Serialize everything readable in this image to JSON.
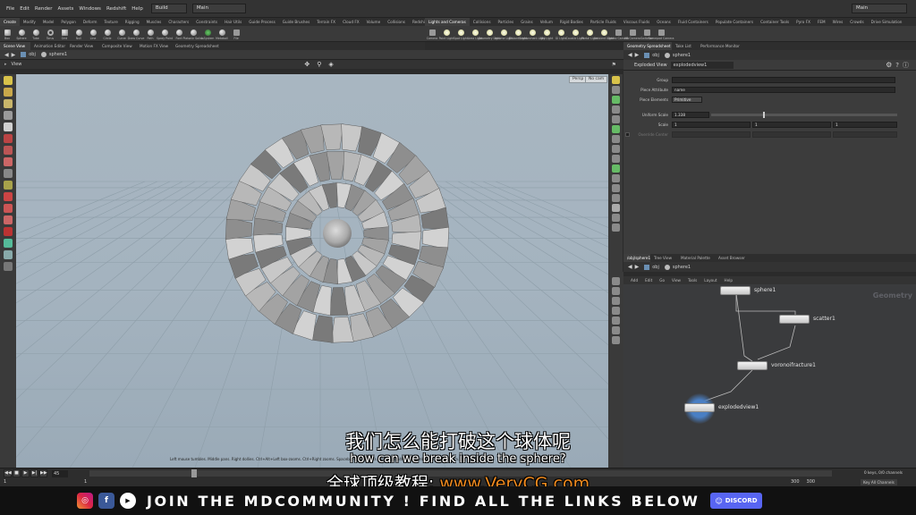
{
  "menubar": {
    "menus": [
      "File",
      "Edit",
      "Render",
      "Assets",
      "Windows",
      "Redshift",
      "Help"
    ],
    "desktop": "Build",
    "context": "Main",
    "right_desktop": "Main"
  },
  "shelf": {
    "tabs": [
      "Create",
      "Modify",
      "Model",
      "Polygon",
      "Deform",
      "Texture",
      "Rigging",
      "Muscles",
      "Characters",
      "Constraints",
      "Hair Utils",
      "Guide Process",
      "Guide Brushes",
      "Terrain FX",
      "Cloud FX",
      "Volume",
      "Collisions",
      "Redshift"
    ],
    "tools": [
      "Box",
      "Sphere",
      "Tube",
      "Torus",
      "Grid",
      "Null",
      "Line",
      "Circle",
      "Curve",
      "Draw Curve",
      "Path",
      "Spray Paint",
      "Font",
      "Platonic Solids",
      "L-System",
      "Metaball",
      "File"
    ],
    "lights_tabs": [
      "Lights and Cameras",
      "Collisions",
      "Particles",
      "Grains",
      "Vellum",
      "Rigid Bodies",
      "Particle Fluids",
      "Viscous Fluids",
      "Oceans",
      "Fluid Containers",
      "Populate Containers",
      "Container Tools",
      "Pyro FX",
      "FEM",
      "Wires",
      "Crowds",
      "Drive Simulation"
    ],
    "lights": [
      "Camera",
      "Point Light",
      "Spot Light",
      "Area Light",
      "Geometry Light",
      "Volume Light",
      "Distant Light",
      "Environment Light",
      "Sky Light",
      "GI Light",
      "Caustic Light",
      "Portal Light",
      "Ambient Light",
      "Stereo Camera",
      "VR Camera",
      "Switcher",
      "Gamepad Camera"
    ]
  },
  "pane_tabs": [
    "Scene View",
    "Animation Editor",
    "Render View",
    "Composite View",
    "Motion FX View",
    "Geometry Spreadsheet"
  ],
  "viewer": {
    "path": "obj",
    "node": "sphere1",
    "title": "View",
    "persp": "Persp",
    "cam": "No cam",
    "status": "Left mouse tumbles. Middle pans. Right dollies. Ctrl+Alt+Left box-zooms. Ctrl+Right zooms. Spacebar-Ctrl-Left tilts. Hold L for alternate tumble, dolly, and zoom."
  },
  "subtitles": {
    "cn": "我们怎么能打破这个球体呢",
    "en": "how can we break inside the sphere?"
  },
  "watermark": {
    "prefix": "全球顶级教程:",
    "url": "www.VeryCG.com"
  },
  "timeline": {
    "frame": "45",
    "start": "1",
    "start2": "1",
    "end": "300",
    "end2": "300",
    "ticks": [
      "1",
      "",
      "",
      "",
      "",
      "",
      "",
      "",
      "",
      "",
      "",
      "",
      "",
      "",
      "",
      ""
    ],
    "keys_label": "0 keys, 0/0 channels",
    "key_all": "Key All Channels"
  },
  "banner": {
    "text": "JOIN THE MDCOMMUNITY ! FIND ALL THE LINKS BELOW",
    "discord": "DISCORD"
  },
  "params": {
    "tabs": [
      "Geometry Spreadsheet",
      "Take List",
      "Performance Monitor"
    ],
    "path": "obj",
    "node": "sphere1",
    "type": "Exploded View",
    "name": "explodedview1",
    "rows": [
      {
        "label": "Group",
        "value": ""
      },
      {
        "label": "Piece Attribute",
        "value": "name"
      },
      {
        "label": "Piece Elements",
        "value": "Primitive"
      },
      {
        "label": "Uniform Scale",
        "value": "1.338"
      },
      {
        "label": "Scale",
        "value": "1",
        "v2": "1",
        "v3": "1"
      },
      {
        "label": "Override Center",
        "value": ""
      }
    ]
  },
  "network": {
    "tabs": [
      "/obj/sphere1",
      "Tree View",
      "Material Palette",
      "Asset Browser"
    ],
    "path": "obj",
    "node": "sphere1",
    "menu": [
      "Add",
      "Edit",
      "Go",
      "View",
      "Tools",
      "Layout",
      "Help"
    ],
    "context_label": "Geometry",
    "nodes": {
      "sphere": "sphere1",
      "scatter": "scatter1",
      "voronoi": "voronoifracture1",
      "exploded": "explodedview1"
    }
  }
}
